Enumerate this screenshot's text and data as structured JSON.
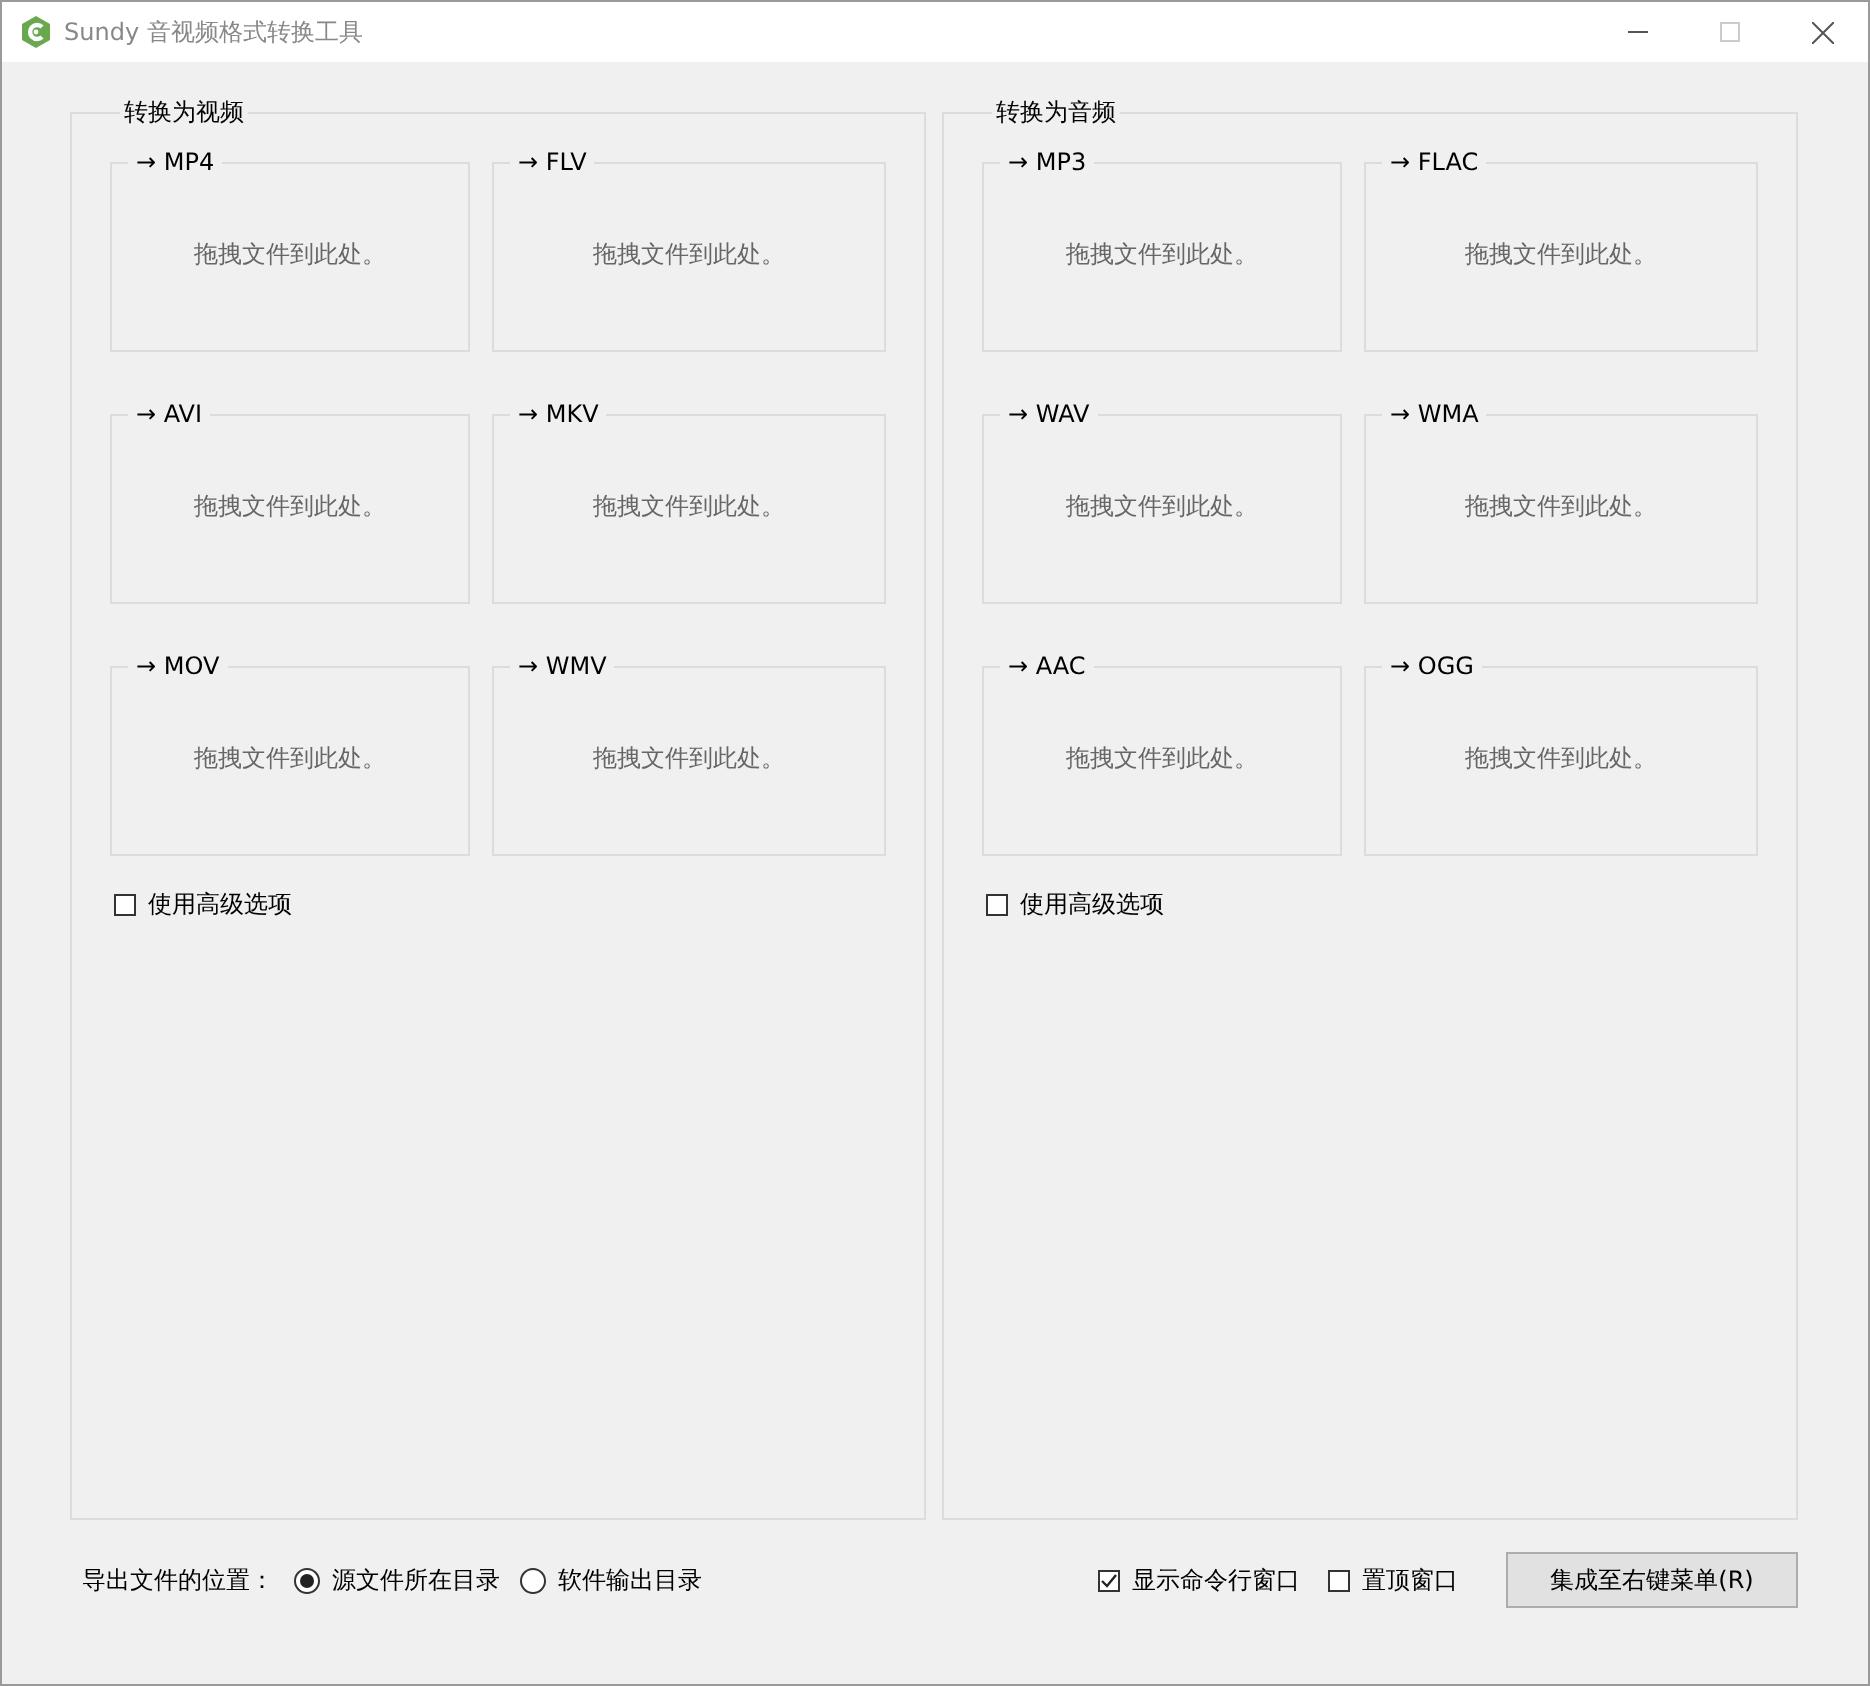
{
  "window": {
    "title": "Sundy 音视频格式转换工具"
  },
  "groups": [
    {
      "title": "转换为视频",
      "targets": [
        {
          "label": "→ MP4",
          "hint": "拖拽文件到此处。"
        },
        {
          "label": "→ FLV",
          "hint": "拖拽文件到此处。"
        },
        {
          "label": "→ AVI",
          "hint": "拖拽文件到此处。"
        },
        {
          "label": "→ MKV",
          "hint": "拖拽文件到此处。"
        },
        {
          "label": "→ MOV",
          "hint": "拖拽文件到此处。"
        },
        {
          "label": "→ WMV",
          "hint": "拖拽文件到此处。"
        }
      ],
      "advanced": {
        "label": "使用高级选项",
        "checked": false
      }
    },
    {
      "title": "转换为音频",
      "targets": [
        {
          "label": "→ MP3",
          "hint": "拖拽文件到此处。"
        },
        {
          "label": "→ FLAC",
          "hint": "拖拽文件到此处。"
        },
        {
          "label": "→ WAV",
          "hint": "拖拽文件到此处。"
        },
        {
          "label": "→ WMA",
          "hint": "拖拽文件到此处。"
        },
        {
          "label": "→ AAC",
          "hint": "拖拽文件到此处。"
        },
        {
          "label": "→ OGG",
          "hint": "拖拽文件到此处。"
        }
      ],
      "advanced": {
        "label": "使用高级选项",
        "checked": false
      }
    }
  ],
  "output_location": {
    "label": "导出文件的位置：",
    "options": [
      {
        "label": "源文件所在目录",
        "selected": true
      },
      {
        "label": "软件输出目录",
        "selected": false
      }
    ]
  },
  "options": [
    {
      "label": "显示命令行窗口",
      "checked": true
    },
    {
      "label": "置顶窗口",
      "checked": false
    }
  ],
  "button": {
    "label": "集成至右键菜单(R)"
  }
}
